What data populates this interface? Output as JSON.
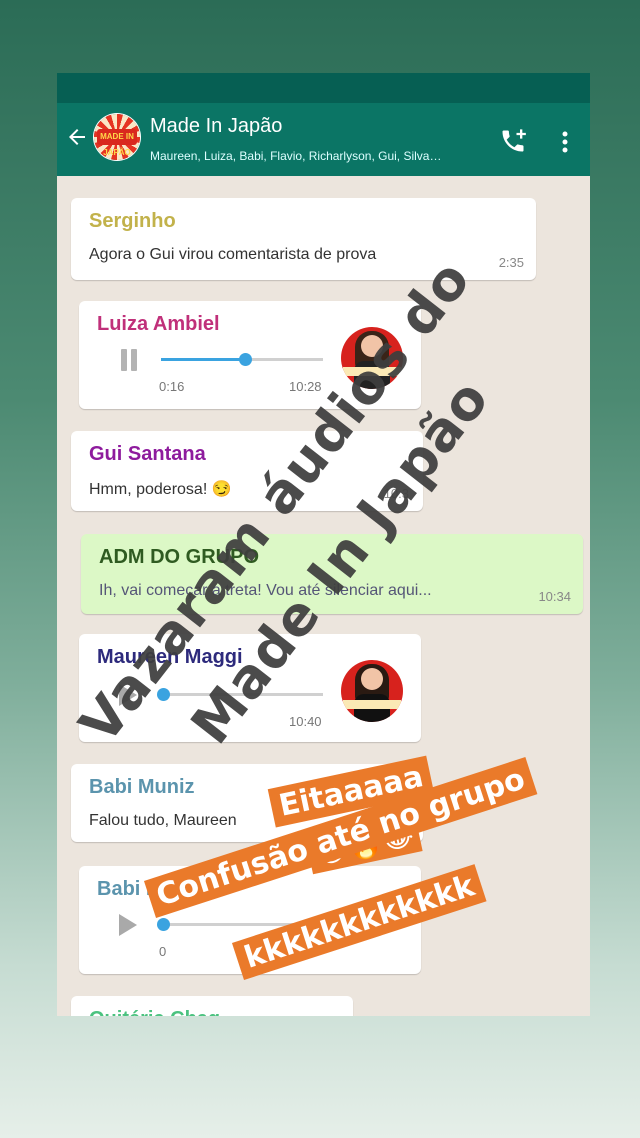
{
  "header": {
    "title": "Made In Japão",
    "members": "Maureen, Luiza, Babi, Flavio, Richarlyson, Gui, Silva…",
    "logo_text": "MADE IN JAPÃO"
  },
  "messages": [
    {
      "sender": "Serginho",
      "text": "Agora o Gui virou comentarista de prova",
      "time": "2:35",
      "color": "#c2b24b"
    },
    {
      "sender": "Luiza Ambiel",
      "type": "voice",
      "elapsed": "0:16",
      "time": "10:28",
      "progress": 0.5,
      "color": "#c0307a"
    },
    {
      "sender": "Gui Santana",
      "text": "Hmm, poderosa!",
      "time": "10:3",
      "color": "#8e1b9d"
    },
    {
      "sender": "ADM DO GRUPO",
      "text": "Ih, vai começar a treta! Vou até silenciar aqui...",
      "time": "10:34",
      "color": "#2f5b21"
    },
    {
      "sender": "Maureen Maggi",
      "type": "voice",
      "time": "10:40",
      "progress": 0.0,
      "color": "#2d2a7c"
    },
    {
      "sender": "Babi Muniz",
      "text": "Falou tudo, Maureen",
      "color": "#5b94ad"
    },
    {
      "sender": "Babi Muniz",
      "type": "voice",
      "elapsed": "0",
      "progress": 0.0,
      "color": "#5b94ad"
    },
    {
      "sender": "Quitéria Chag",
      "color": "#4bc27f"
    }
  ],
  "overlay": {
    "line1": "Vazaram áudios do",
    "line2": "Made In Japão"
  },
  "stickers": {
    "eitaaa": "Eitaaaaa",
    "emojis": "😂🔥😂",
    "confusao": "Confusão até no grupo",
    "kkk": "kkkkkkkkkkkk"
  },
  "icons": [
    "back-arrow-icon",
    "add-call-icon",
    "more-vert-icon",
    "pause-icon",
    "play-icon",
    "smirk-emoji",
    "laugh-emoji",
    "fire-emoji"
  ]
}
